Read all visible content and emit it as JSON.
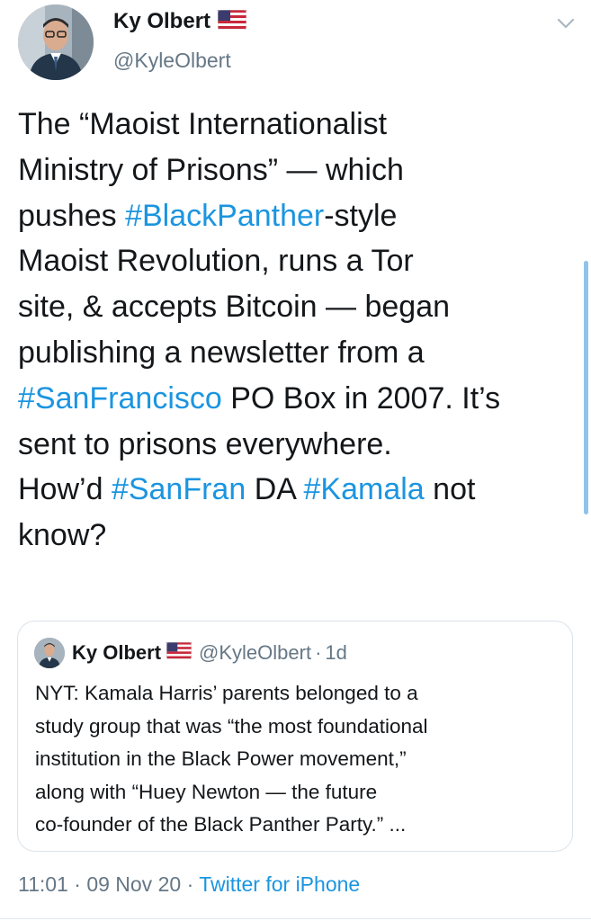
{
  "author": {
    "name": "Ky Olbert",
    "handle": "@KyleOlbert"
  },
  "tweet": {
    "lines": [
      [
        {
          "t": "The “Maoist Internationalist"
        }
      ],
      [
        {
          "t": "Ministry of Prisons” — which"
        }
      ],
      [
        {
          "t": "pushes "
        },
        {
          "t": "#BlackPanther",
          "h": true
        },
        {
          "t": "-style"
        }
      ],
      [
        {
          "t": "Maoist Revolution, runs a Tor"
        }
      ],
      [
        {
          "t": "site, & accepts Bitcoin — began"
        }
      ],
      [
        {
          "t": "publishing a newsletter from a"
        }
      ],
      [
        {
          "t": "#SanFrancisco",
          "h": true
        },
        {
          "t": " PO Box in 2007. It’s"
        }
      ],
      [
        {
          "t": "sent to prisons everywhere."
        }
      ],
      [
        {
          "t": " "
        }
      ],
      [
        {
          "t": "How’d "
        },
        {
          "t": "#SanFran",
          "h": true
        },
        {
          "t": " DA "
        },
        {
          "t": "#Kamala",
          "h": true
        },
        {
          "t": " not"
        }
      ],
      [
        {
          "t": "know?"
        }
      ]
    ]
  },
  "quoted": {
    "name": "Ky Olbert",
    "handle": "@KyleOlbert",
    "separator": "·",
    "age": "1d",
    "lines": [
      "NYT: Kamala Harris’ parents belonged to a",
      "study group that was “the most foundational",
      "institution in the Black Power movement,”",
      "along with “Huey Newton — the future",
      "co-founder of the Black Panther Party.” ..."
    ]
  },
  "footer": {
    "time": "11:01",
    "dot1": "·",
    "date": "09 Nov 20",
    "dot2": "·",
    "source": "Twitter for iPhone"
  },
  "colors": {
    "link": "#1b95e0",
    "text": "#14171a",
    "muted": "#657786"
  },
  "icons": [
    "us-flag-icon",
    "chevron-down-icon",
    "avatar"
  ]
}
